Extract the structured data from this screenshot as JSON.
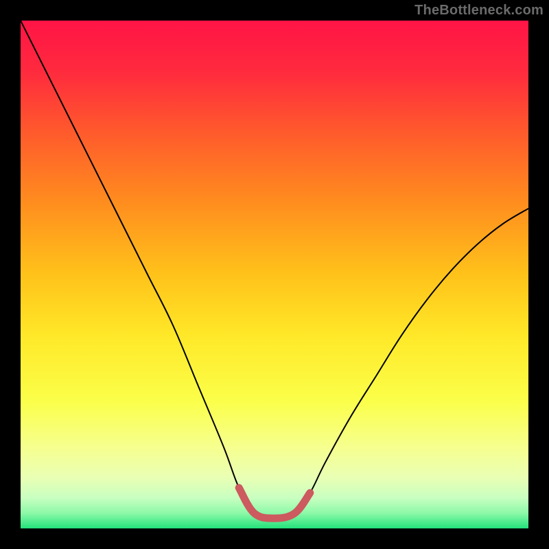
{
  "watermark": "TheBottleneck.com",
  "colors": {
    "background": "#000000",
    "gradient_stops": [
      {
        "offset": 0.0,
        "color": "#ff1446"
      },
      {
        "offset": 0.1,
        "color": "#ff2a3e"
      },
      {
        "offset": 0.22,
        "color": "#ff5a2c"
      },
      {
        "offset": 0.35,
        "color": "#ff8a1f"
      },
      {
        "offset": 0.5,
        "color": "#ffc21a"
      },
      {
        "offset": 0.62,
        "color": "#ffe828"
      },
      {
        "offset": 0.75,
        "color": "#fbff4a"
      },
      {
        "offset": 0.84,
        "color": "#f6ff8e"
      },
      {
        "offset": 0.9,
        "color": "#e9ffb4"
      },
      {
        "offset": 0.94,
        "color": "#c8ffc0"
      },
      {
        "offset": 0.97,
        "color": "#8cf9a8"
      },
      {
        "offset": 1.0,
        "color": "#23e27a"
      }
    ],
    "curve": "#000000",
    "highlight": "#cc5a5f"
  },
  "chart_data": {
    "type": "line",
    "title": "",
    "xlabel": "",
    "ylabel": "",
    "xlim": [
      0,
      100
    ],
    "ylim": [
      0,
      100
    ],
    "series": [
      {
        "name": "bottleneck-curve",
        "x": [
          0,
          5,
          10,
          15,
          20,
          25,
          30,
          35,
          40,
          43,
          46,
          50,
          54,
          57,
          60,
          65,
          70,
          75,
          80,
          85,
          90,
          95,
          100
        ],
        "values": [
          100,
          90,
          80,
          70,
          60,
          50,
          40,
          28,
          16,
          8,
          3,
          2,
          3,
          7,
          13,
          22,
          30,
          38,
          45,
          51,
          56,
          60,
          63
        ]
      }
    ],
    "highlight_segment": {
      "x_start": 43,
      "x_end": 57
    },
    "annotations": []
  }
}
